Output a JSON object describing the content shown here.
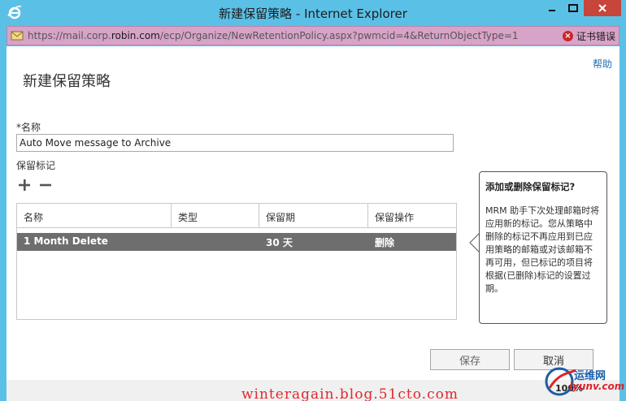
{
  "window": {
    "title": "新建保留策略 - Internet Explorer"
  },
  "address": {
    "url_prefix": "https://mail.corp.",
    "url_host": "robin.com",
    "url_path": "/ecp/Organize/NewRetentionPolicy.aspx?pwmcid=4&ReturnObjectType=1",
    "cert_error": "证书错误"
  },
  "page": {
    "help": "帮助",
    "title": "新建保留策略",
    "name_label": "*名称",
    "name_value": "Auto Move message to Archive",
    "tags_label": "保留标记"
  },
  "grid": {
    "columns": [
      "名称",
      "类型",
      "保留期",
      "保留操作"
    ],
    "rows": [
      {
        "name": "1 Month Delete",
        "type": "",
        "period": "30 天",
        "action": "删除"
      }
    ]
  },
  "tooltip": {
    "title": "添加或删除保留标记?",
    "body": "MRM 助手下次处理邮箱时将应用新的标记。您从策略中删除的标记不再应用到已应用策略的邮箱或对该邮箱不再可用，但已标记的项目将根据(已删除)标记的设置过期。"
  },
  "buttons": {
    "save": "保存",
    "cancel": "取消"
  },
  "status": {
    "zoom": "100%"
  },
  "overlay": {
    "watermark": "winteragain.blog.51cto.com",
    "logo_cn": "运维网",
    "logo_url": "iyunv.com"
  },
  "colors": {
    "title_bar": "#5bc0e6",
    "address_bar": "#d8a3c8",
    "selected_row": "#6e6e6e",
    "link": "#1f6fb2"
  }
}
